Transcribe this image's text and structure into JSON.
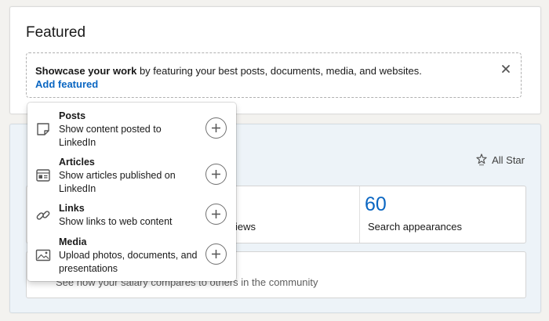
{
  "featured": {
    "title": "Featured",
    "showcase_bold": "Showcase your work",
    "showcase_rest": " by featuring your best posts, documents, media, and websites.",
    "add_link": "Add featured",
    "close_icon": "close-icon"
  },
  "dashboard": {
    "all_star_label": "All Star",
    "stat_views_partial": "iews",
    "stat_search_value": "60",
    "stat_search_label": "Search appearances",
    "salary_text": "See how your salary compares to others in the community"
  },
  "menu": {
    "items": [
      {
        "title": "Posts",
        "desc": "Show content posted to LinkedIn",
        "icon": "post-icon"
      },
      {
        "title": "Articles",
        "desc": "Show articles published on LinkedIn",
        "icon": "article-icon"
      },
      {
        "title": "Links",
        "desc": "Show links to web content",
        "icon": "link-icon"
      },
      {
        "title": "Media",
        "desc": "Upload photos, documents, and presentations",
        "icon": "media-icon"
      }
    ]
  },
  "colors": {
    "accent": "#0a66c2",
    "page_bg": "#f3f2ef",
    "dashboard_bg": "#edf3f8"
  }
}
